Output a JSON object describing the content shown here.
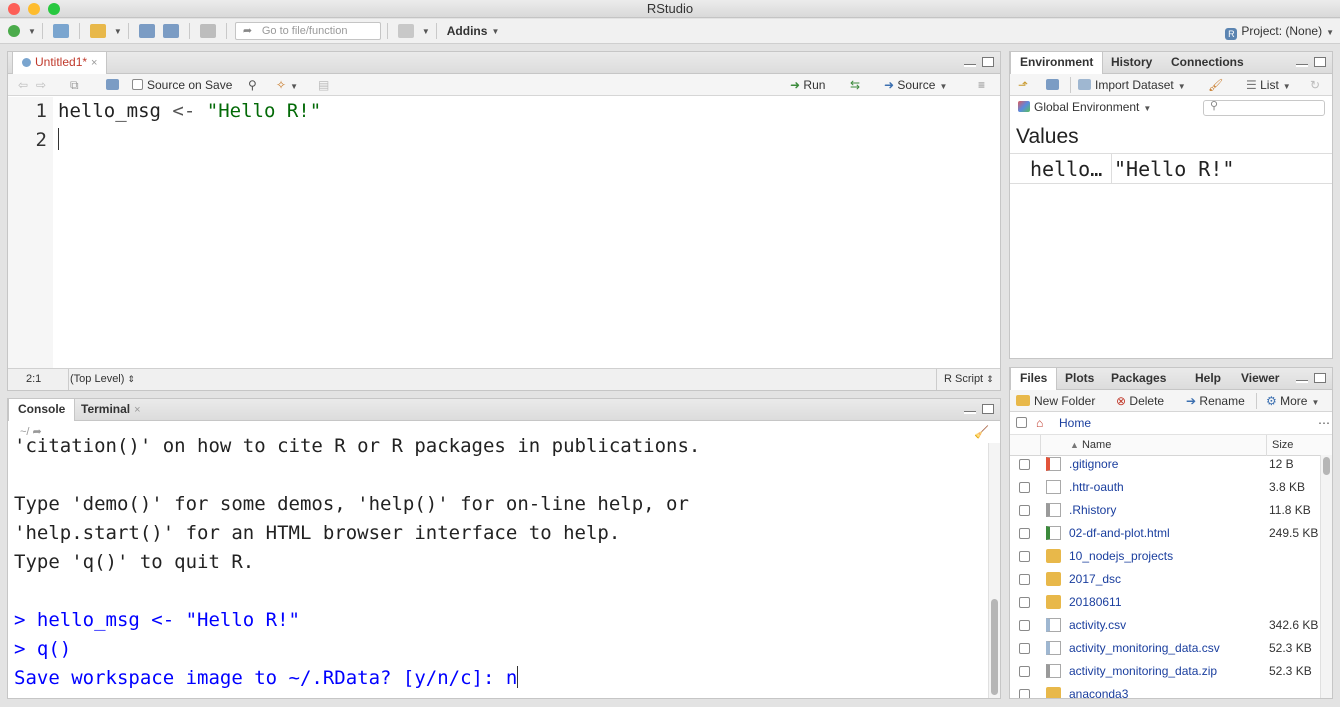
{
  "window": {
    "title": "RStudio"
  },
  "toolbar": {
    "goto_placeholder": "Go to file/function",
    "addins_label": "Addins",
    "project_label": "Project: (None)"
  },
  "source": {
    "tab_label": "Untitled1*",
    "source_on_save_label": "Source on Save",
    "run_label": "Run",
    "source_label": "Source",
    "gutter": [
      "1",
      "2"
    ],
    "code_line1": {
      "var": "hello_msg",
      "op": "<-",
      "str": "\"Hello R!\""
    },
    "status_position": "2:1",
    "status_scope": "(Top Level)",
    "status_type": "R Script"
  },
  "console": {
    "tabs": [
      "Console",
      "Terminal"
    ],
    "path": "~/",
    "lines": [
      {
        "text": "'citation()' on how to cite R or R packages in publications.",
        "style": "normal"
      },
      {
        "text": "",
        "style": "normal"
      },
      {
        "text": "Type 'demo()' for some demos, 'help()' for on-line help, or",
        "style": "normal"
      },
      {
        "text": "'help.start()' for an HTML browser interface to help.",
        "style": "normal"
      },
      {
        "text": "Type 'q()' to quit R.",
        "style": "normal"
      },
      {
        "text": "",
        "style": "normal"
      },
      {
        "text": "> hello_msg <- \"Hello R!\"",
        "style": "blue"
      },
      {
        "text": "> q()",
        "style": "blue"
      },
      {
        "text": "Save workspace image to ~/.RData? [y/n/c]: n",
        "style": "blue"
      }
    ]
  },
  "environment": {
    "tabs": [
      "Environment",
      "History",
      "Connections"
    ],
    "import_label": "Import Dataset",
    "list_label": "List",
    "scope_label": "Global Environment",
    "values_header": "Values",
    "rows": [
      {
        "name": "hello…",
        "value": "\"Hello R!\""
      }
    ]
  },
  "files": {
    "tabs": [
      "Files",
      "Plots",
      "Packages",
      "Help",
      "Viewer"
    ],
    "new_folder_label": "New Folder",
    "delete_label": "Delete",
    "rename_label": "Rename",
    "more_label": "More",
    "breadcrumb": "Home",
    "col_name": "Name",
    "col_size": "Size",
    "items": [
      {
        "name": ".gitignore",
        "size": "12 B",
        "icon": "git-file-icon"
      },
      {
        "name": ".httr-oauth",
        "size": "3.8 KB",
        "icon": "file-icon"
      },
      {
        "name": ".Rhistory",
        "size": "11.8 KB",
        "icon": "history-file-icon"
      },
      {
        "name": "02-df-and-plot.html",
        "size": "249.5 KB",
        "icon": "html-file-icon"
      },
      {
        "name": "10_nodejs_projects",
        "size": "",
        "icon": "folder-icon"
      },
      {
        "name": "2017_dsc",
        "size": "",
        "icon": "folder-icon"
      },
      {
        "name": "20180611",
        "size": "",
        "icon": "folder-icon"
      },
      {
        "name": "activity.csv",
        "size": "342.6 KB",
        "icon": "csv-file-icon"
      },
      {
        "name": "activity_monitoring_data.csv",
        "size": "52.3 KB",
        "icon": "csv-file-icon"
      },
      {
        "name": "activity_monitoring_data.zip",
        "size": "52.3 KB",
        "icon": "zip-file-icon"
      },
      {
        "name": "anaconda3",
        "size": "",
        "icon": "folder-icon"
      }
    ]
  },
  "colors": {
    "code_string": "#036a07",
    "console_input": "#0000ff",
    "accent_blue": "#1a3e9e"
  }
}
